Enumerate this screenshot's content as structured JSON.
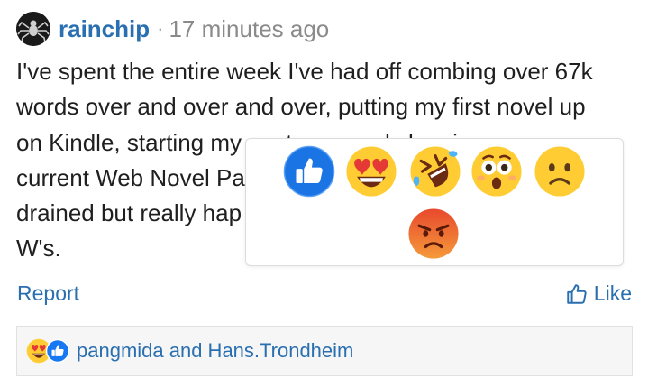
{
  "post": {
    "author": "rainchip",
    "separator": "·",
    "time": "17 minutes ago",
    "body_lines": [
      "I've spent the entire week I've had off combing over 67k",
      "words over and over and over, putting my first novel up",
      "on Kindle, starting my next one, and cleaning up my",
      "current Web Novel Pa",
      "drained but really hap",
      "W's."
    ]
  },
  "actions": {
    "report": "Report",
    "like": "Like"
  },
  "reactions": {
    "reactors": "pangmida and Hans.Trondheim",
    "popup_options": [
      "like",
      "love",
      "laugh",
      "wow",
      "sad",
      "angry"
    ]
  },
  "colors": {
    "link": "#2a6fb0",
    "muted": "#8a8a8a",
    "text": "#1f1f1f",
    "like_blue": "#1877f2",
    "emoji_yellow": "#ffcc33",
    "angry_red": "#e8492e"
  }
}
